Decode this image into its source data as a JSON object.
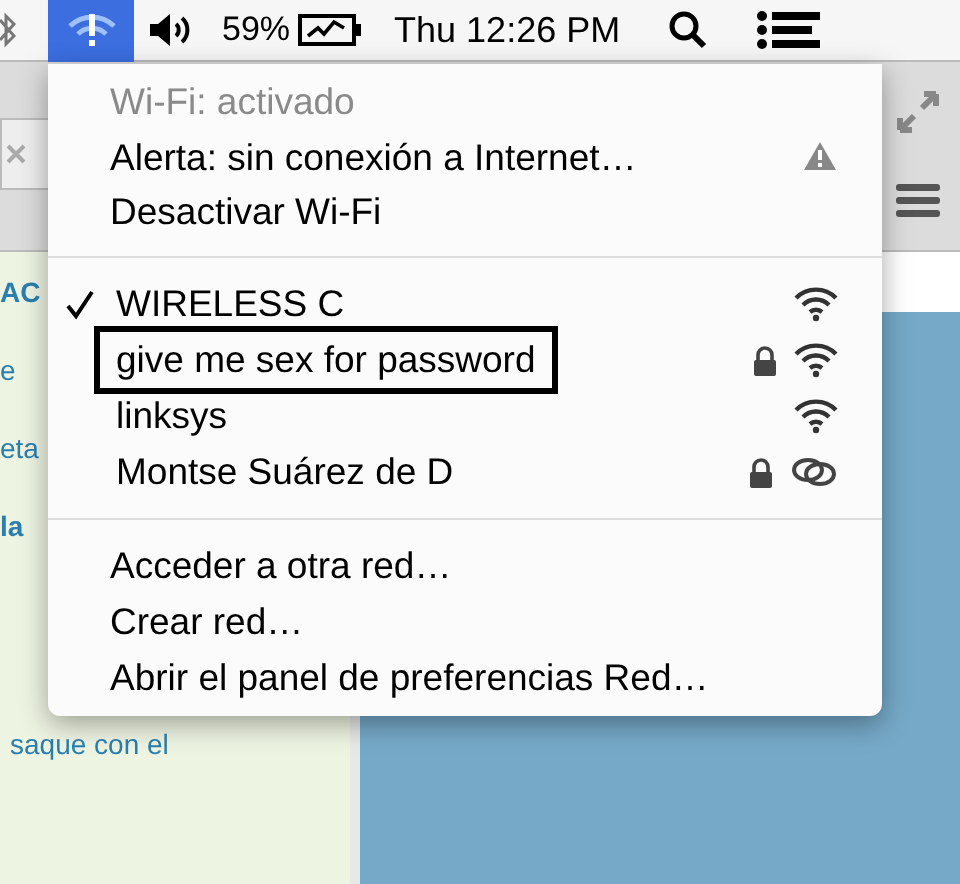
{
  "menu_bar": {
    "wifi": {
      "selected": true
    },
    "battery": "59%",
    "clock": "Thu 12:26 PM"
  },
  "background_window": {
    "fragments": [
      {
        "text": "AC",
        "bold": true
      },
      {
        "text": "e",
        "bold": false
      },
      {
        "text": "eta",
        "bold": false
      },
      {
        "text": "la",
        "bold": true
      },
      {
        "text": "saque con el",
        "bold": false
      }
    ]
  },
  "wifi_menu": {
    "status": {
      "text": "Wi-Fi: activado",
      "disabled": true
    },
    "alert": "Alerta: sin conexión a Internet…",
    "toggle": "Desactivar Wi-Fi",
    "networks": [
      {
        "name": "WIRELESS C",
        "selected": true,
        "locked": false,
        "outlined": false,
        "kind": "wifi"
      },
      {
        "name": "give me sex for password",
        "selected": false,
        "locked": true,
        "outlined": true,
        "kind": "wifi"
      },
      {
        "name": "linksys",
        "selected": false,
        "locked": false,
        "outlined": false,
        "kind": "wifi"
      },
      {
        "name": "Montse Suárez de D",
        "selected": false,
        "locked": true,
        "outlined": false,
        "kind": "adhoc"
      }
    ],
    "actions": [
      "Acceder a otra red…",
      "Crear red…",
      "Abrir el panel de preferencias Red…"
    ]
  }
}
